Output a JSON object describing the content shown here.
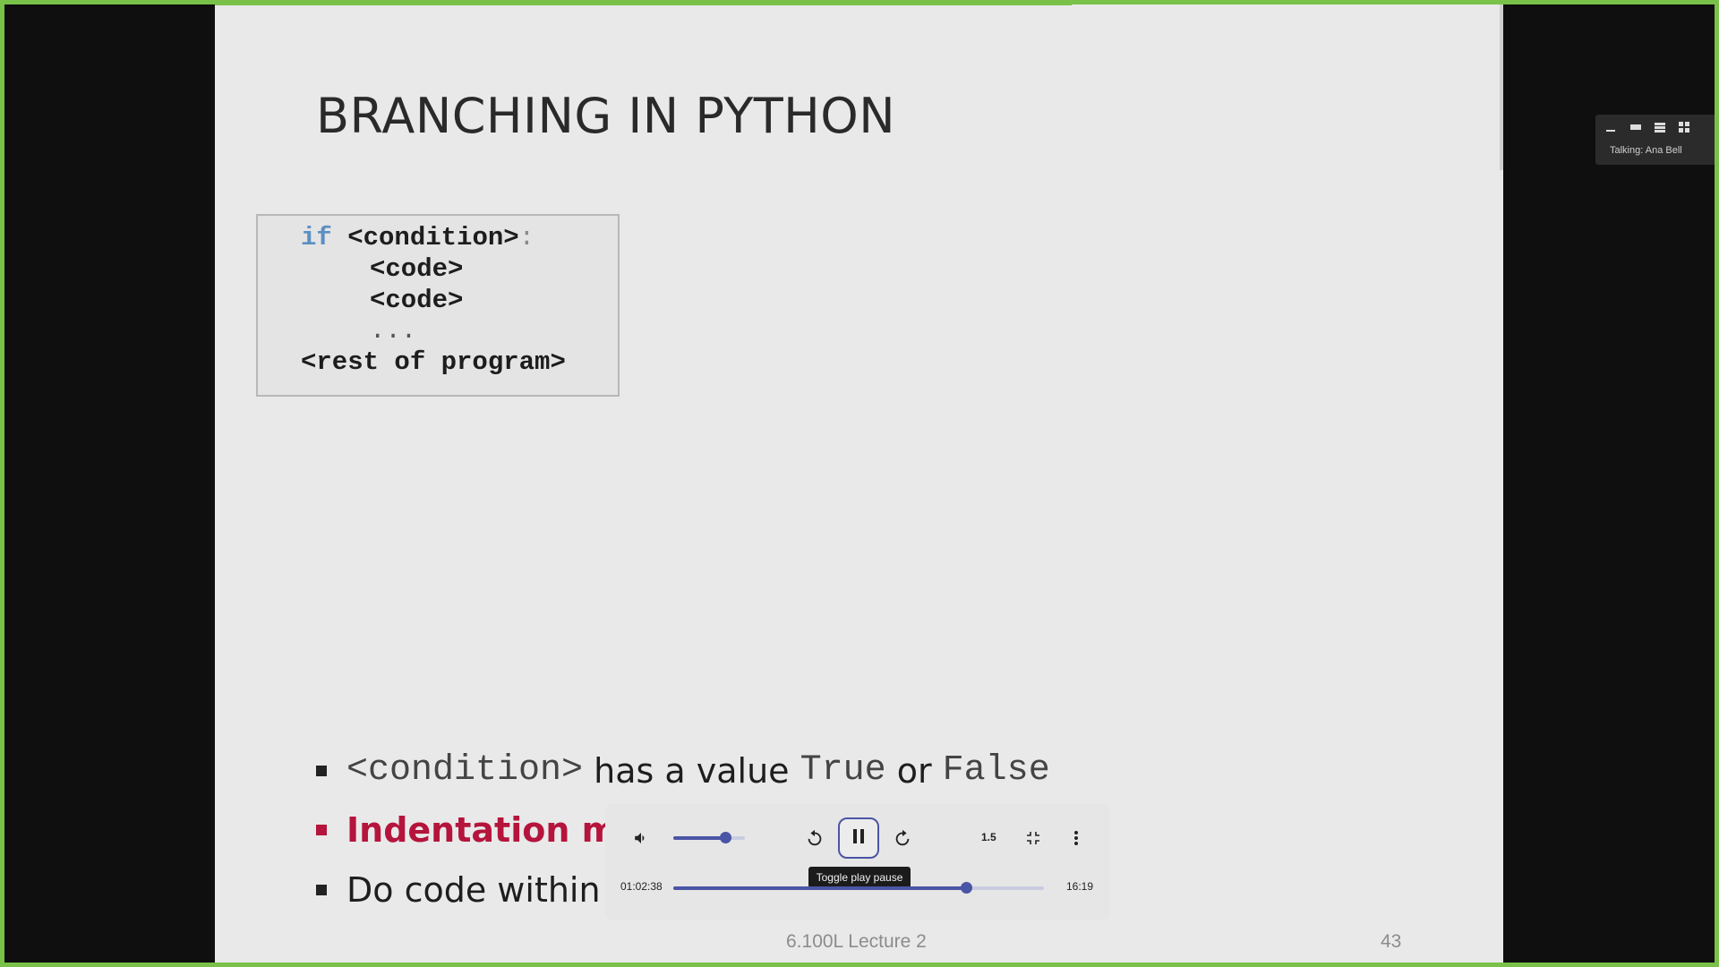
{
  "slide": {
    "title": "BRANCHING IN PYTHON",
    "code": {
      "keyword_if": "if",
      "condition": " <condition>",
      "colon": ":",
      "line2": "<code>",
      "line3": "<code>",
      "line4": "...",
      "line5": "<rest of program>"
    },
    "bullets": {
      "b1_mono_a": "<condition>",
      "b1_text_a": " has a value ",
      "b1_mono_b": "True",
      "b1_text_b": " or ",
      "b1_mono_c": "False",
      "b2_text": "Indentation mat",
      "b3_text": "Do code within i"
    },
    "footer_center": "6.100L Lecture 2",
    "footer_number": "43"
  },
  "view_widget": {
    "label": "Talking: Ana Bell"
  },
  "player": {
    "tooltip": "Toggle play pause",
    "speed": "1.5",
    "current_time": "01:02:38",
    "duration": "16:19",
    "volume_level": 0.72,
    "progress": 0.79,
    "rewind_seconds": "15",
    "forward_seconds": "15",
    "accent_color": "#4b55a5"
  },
  "frame_color": "#79c148"
}
